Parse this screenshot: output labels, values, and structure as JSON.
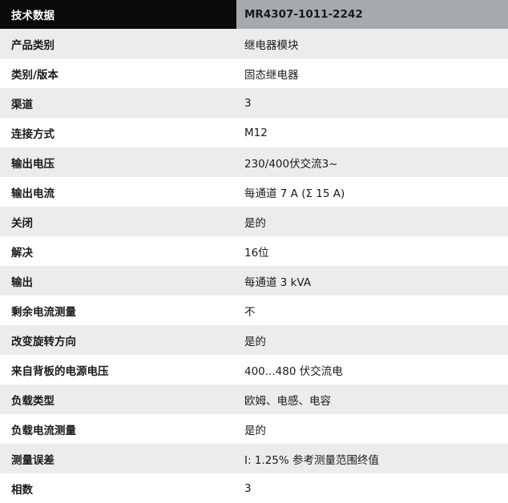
{
  "header": {
    "label": "技术数据",
    "model": "MR4307-1011-2242"
  },
  "rows": [
    {
      "key": "产品类别",
      "value": "继电器模块"
    },
    {
      "key": "类别/版本",
      "value": "固态继电器"
    },
    {
      "key": "渠道",
      "value": "3"
    },
    {
      "key": "连接方式",
      "value": "M12"
    },
    {
      "key": "输出电压",
      "value": "230/400伏交流3~"
    },
    {
      "key": "输出电流",
      "value": "每通道 7 A (Σ 15 A)"
    },
    {
      "key": "关闭",
      "value": "是的"
    },
    {
      "key": "解决",
      "value": "16位"
    },
    {
      "key": "输出",
      "value": "每通道 3 kVA"
    },
    {
      "key": "剩余电流测量",
      "value": "不"
    },
    {
      "key": "改变旋转方向",
      "value": "是的"
    },
    {
      "key": "来自背板的电源电压",
      "value": "400...480 伏交流电"
    },
    {
      "key": "负载类型",
      "value": "欧姆、电感、电容"
    },
    {
      "key": "负载电流测量",
      "value": "是的"
    },
    {
      "key": "测量误差",
      "value": "I: 1.25% 参考测量范围终值"
    },
    {
      "key": "相数",
      "value": "3"
    }
  ]
}
